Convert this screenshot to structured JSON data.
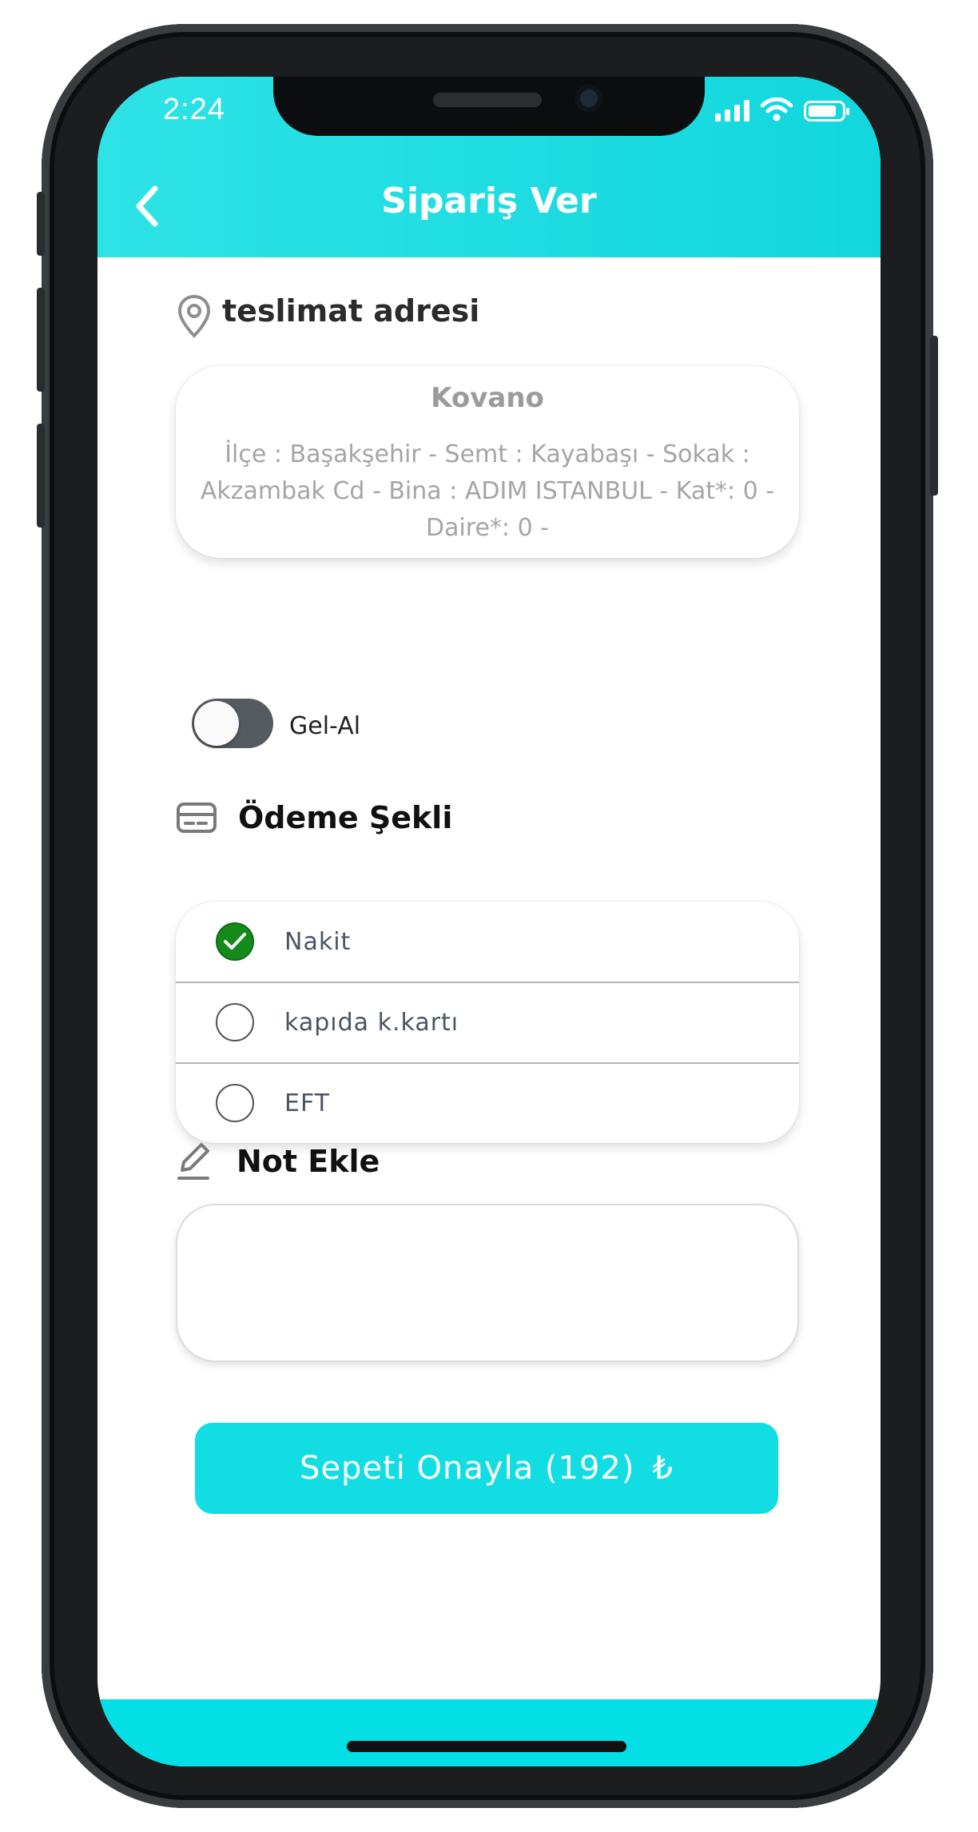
{
  "status_bar": {
    "time": "2:24"
  },
  "header": {
    "title": "Sipariş Ver"
  },
  "delivery": {
    "heading": "teslimat adresi",
    "address_name": "Kovano",
    "address_line_1": "İlçe : Başakşehir - Semt : Kayabaşı - Sokak :",
    "address_line_2": "Akzambak Cd - Bina : ADIM ISTANBUL - Kat*: 0 -",
    "address_line_3": "Daire*: 0 -"
  },
  "pickup": {
    "label": "Gel-Al",
    "enabled": false
  },
  "payment": {
    "heading": "Ödeme Şekli",
    "options": [
      {
        "label": "Nakit",
        "selected": true
      },
      {
        "label": "kapıda k.kartı",
        "selected": false
      },
      {
        "label": "EFT",
        "selected": false
      }
    ]
  },
  "note": {
    "heading": "Not Ekle",
    "value": ""
  },
  "confirm": {
    "label": "Sepeti Onayla (192)",
    "currency_symbol": "₺"
  },
  "colors": {
    "accent": "#12dde3",
    "selected_radio": "#138a1a"
  }
}
